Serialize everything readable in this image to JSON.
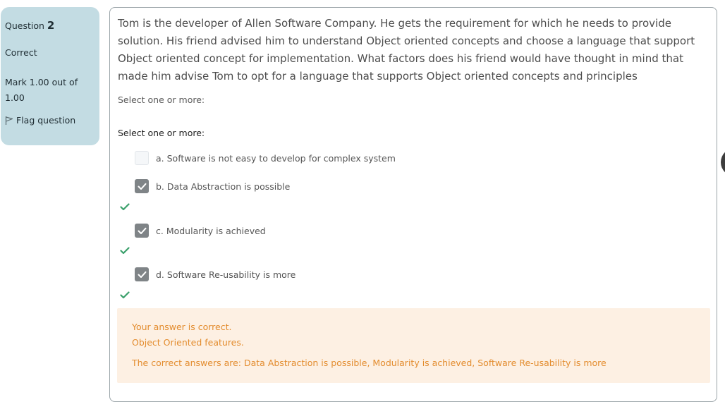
{
  "info": {
    "question_label": "Question",
    "question_number": "2",
    "state": "Correct",
    "grade": "Mark 1.00 out of 1.00",
    "flag_label": "Flag question"
  },
  "question": {
    "text": "Tom is the developer of Allen Software Company. He gets the requirement for which he needs to provide solution. His friend advised him  to understand Object oriented concepts and choose a language that support Object oriented concept for implementation. What factors does his friend would have thought in mind that made him advise Tom to opt for a language that supports Object oriented concepts and principles",
    "prompt_upper": "Select one or more:",
    "prompt_lower": "Select one or more:",
    "options": [
      {
        "label": "a. Software is not easy to develop for complex system",
        "checked": false,
        "correct_mark": false
      },
      {
        "label": "b. Data Abstraction is possible",
        "checked": true,
        "correct_mark": true
      },
      {
        "label": "c. Modularity is achieved",
        "checked": true,
        "correct_mark": true
      },
      {
        "label": "d. Software Re-usability is more",
        "checked": true,
        "correct_mark": true
      }
    ]
  },
  "feedback": {
    "status": "Your answer is correct.",
    "general": "Object Oriented features.",
    "right_answer": "The correct answers are: Data Abstraction is possible, Modularity is achieved, Software Re-usability is more"
  },
  "colors": {
    "info_bg": "#c3dce3",
    "feedback_bg": "#fdf0e3",
    "feedback_text": "#e38c2e",
    "checkbox_checked": "#7f8487",
    "correct_tick": "#3aa06b"
  }
}
